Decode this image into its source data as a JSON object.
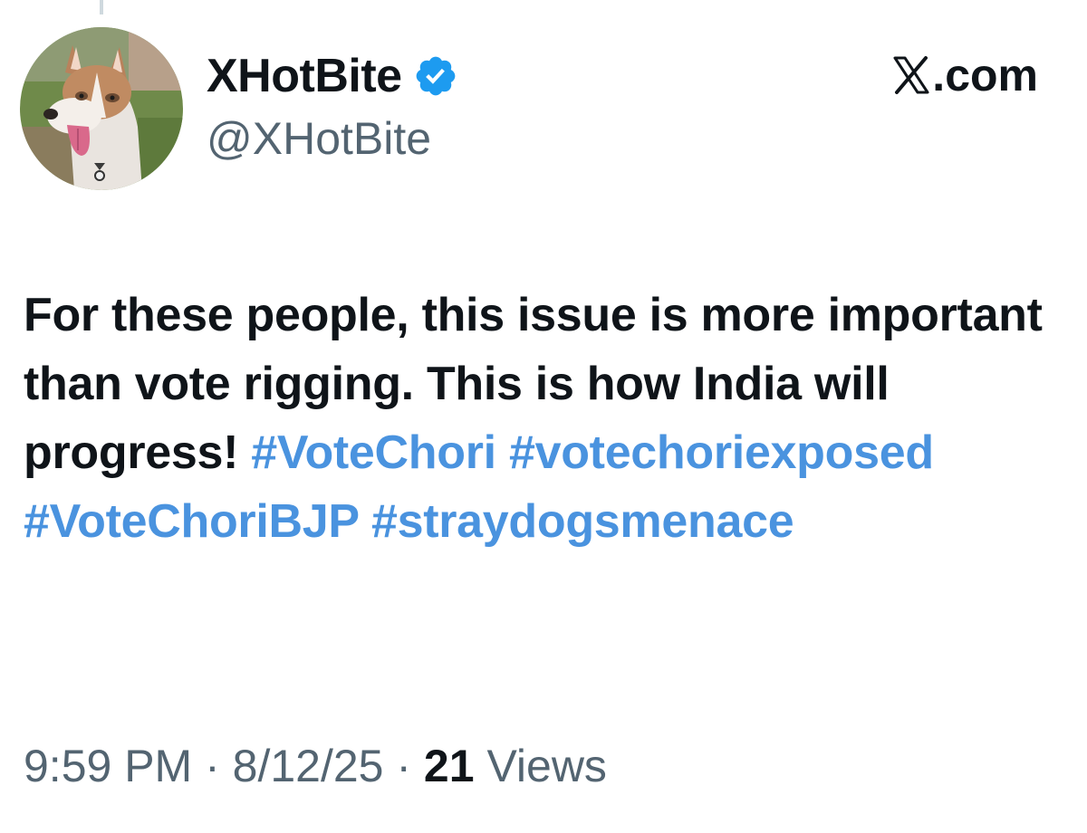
{
  "user": {
    "display_name": "XHotBite",
    "handle": "@XHotBite",
    "verified": true,
    "avatar": "husky-dog-photo"
  },
  "brand": {
    "label": ".com",
    "logo": "x-logo-icon"
  },
  "tweet": {
    "text": "For these people, this issue is more important than vote rigging. This is how India will progress!",
    "hashtags": [
      "#VoteChori",
      "#votechoriexposed",
      "#VoteChoriBJP",
      "#straydogsmenace"
    ]
  },
  "meta": {
    "time": "9:59 PM",
    "separator": " · ",
    "date": "8/12/25",
    "views_count": "21",
    "views_label": "Views"
  },
  "colors": {
    "text": "#0f1419",
    "secondary": "#536471",
    "hashtag": "#4a93df",
    "verified_badge": "#1d9bf0"
  }
}
